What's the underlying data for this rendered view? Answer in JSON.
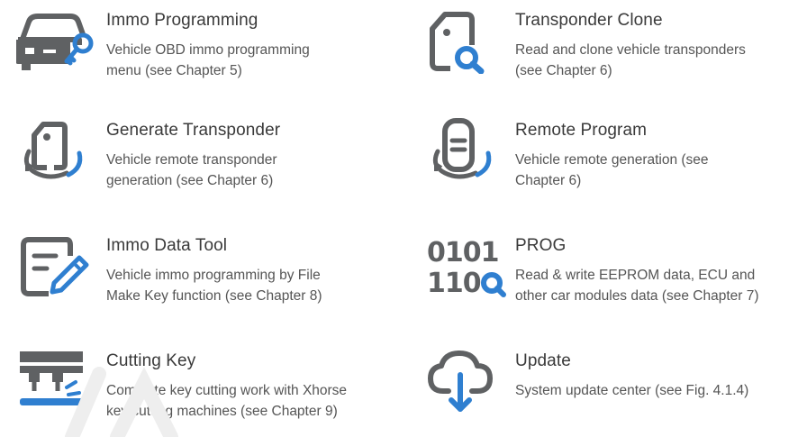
{
  "colors": {
    "icon_gray": "#5f6163",
    "icon_blue": "#2f7fd0",
    "title": "#3a3a3a",
    "desc": "#555555"
  },
  "items": [
    {
      "icon": "car-key-icon",
      "title": "Immo Programming",
      "desc_lines": [
        "Vehicle OBD immo programming",
        "menu (see Chapter 5)"
      ]
    },
    {
      "icon": "transponder-search-icon",
      "title": "Transponder Clone",
      "desc_lines": [
        "Read and clone vehicle transponders",
        "(see Chapter 6)"
      ]
    },
    {
      "icon": "transponder-rotate-icon",
      "title": "Generate Transponder",
      "desc_lines": [
        "Vehicle remote transponder",
        "generation (see Chapter 6)"
      ]
    },
    {
      "icon": "remote-rotate-icon",
      "title": "Remote Program",
      "desc_lines": [
        "Vehicle remote generation (see",
        "Chapter 6)"
      ]
    },
    {
      "icon": "document-pen-icon",
      "title": "Immo Data Tool",
      "desc_lines": [
        "Vehicle immo programming by File",
        "Make Key function (see Chapter 8)"
      ]
    },
    {
      "icon": "binary-search-icon",
      "title": "PROG",
      "desc_lines": [
        "Read & write EEPROM data, ECU and",
        "other car modules data (see Chapter 7)"
      ]
    },
    {
      "icon": "cutting-machine-icon",
      "title": "Cutting Key",
      "desc_lines": [
        "Complete key cutting work with Xhorse",
        "key cutting machines (see Chapter 9)"
      ]
    },
    {
      "icon": "cloud-download-icon",
      "title": "Update",
      "desc_lines": [
        "System update center (see Fig. 4.1.4)"
      ]
    }
  ]
}
